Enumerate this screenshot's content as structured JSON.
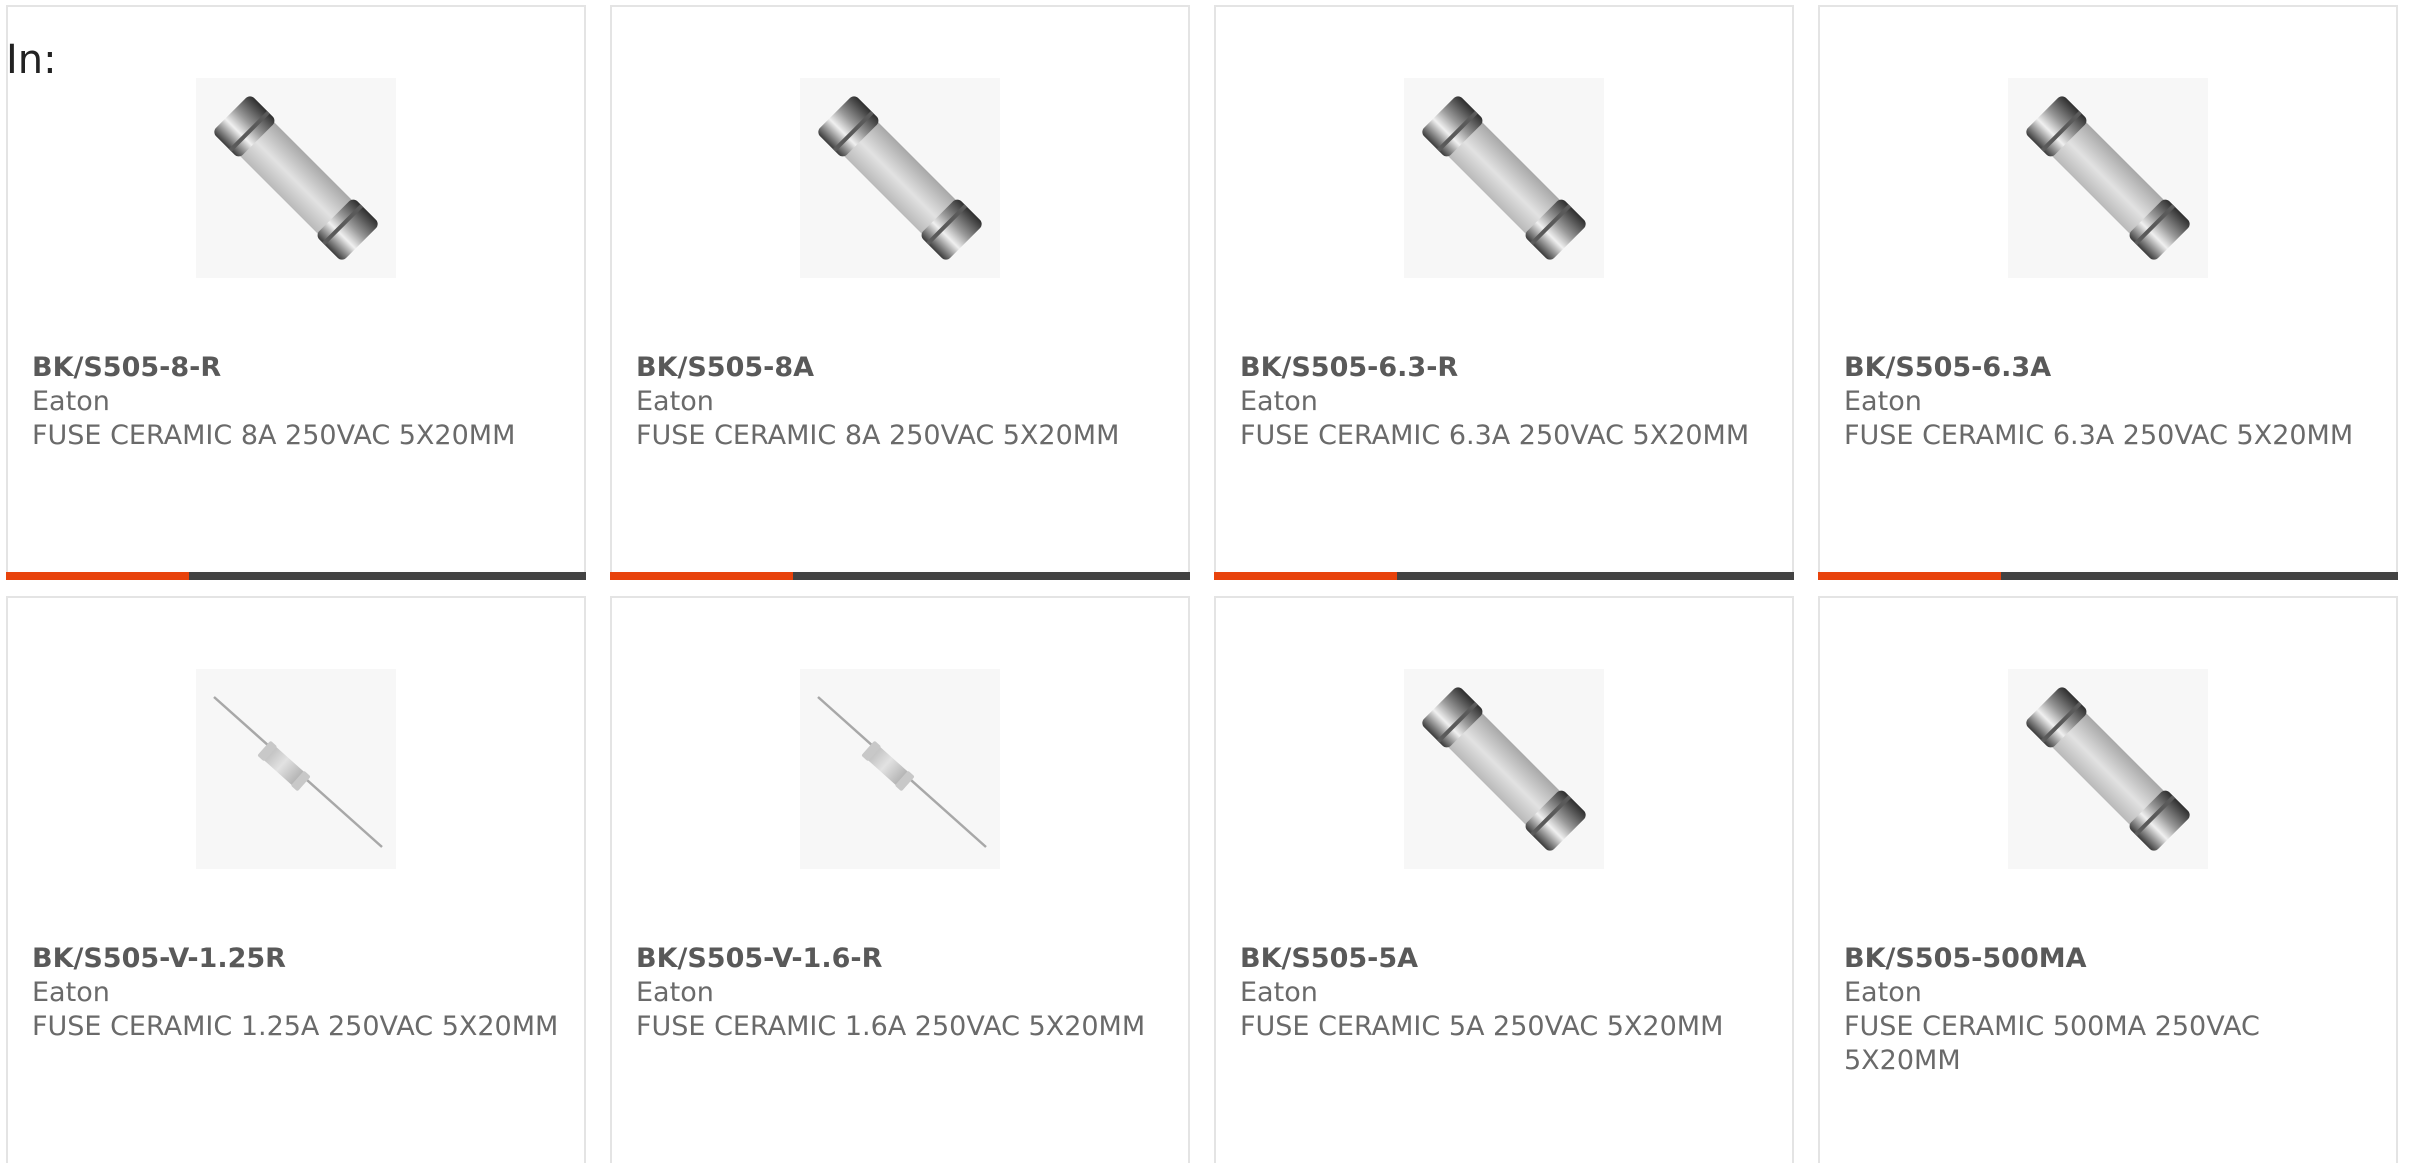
{
  "prefix_text": "In:",
  "colors": {
    "accent": "#e8430c",
    "bar": "#434343",
    "text": "#6a6a6a",
    "border": "#e4e4e4"
  },
  "products": [
    {
      "part": "BK/S505-8-R",
      "brand": "Eaton",
      "description": "FUSE CERAMIC 8A 250VAC 5X20MM",
      "image_icon": "cartridge-fuse-icon"
    },
    {
      "part": "BK/S505-8A",
      "brand": "Eaton",
      "description": "FUSE CERAMIC 8A 250VAC 5X20MM",
      "image_icon": "cartridge-fuse-icon"
    },
    {
      "part": "BK/S505-6.3-R",
      "brand": "Eaton",
      "description": "FUSE CERAMIC 6.3A 250VAC 5X20MM",
      "image_icon": "cartridge-fuse-icon"
    },
    {
      "part": "BK/S505-6.3A",
      "brand": "Eaton",
      "description": "FUSE CERAMIC 6.3A 250VAC 5X20MM",
      "image_icon": "cartridge-fuse-icon"
    },
    {
      "part": "BK/S505-V-1.25R",
      "brand": "Eaton",
      "description": "FUSE CERAMIC 1.25A 250VAC 5X20MM",
      "image_icon": "axial-fuse-icon"
    },
    {
      "part": "BK/S505-V-1.6-R",
      "brand": "Eaton",
      "description": "FUSE CERAMIC 1.6A 250VAC 5X20MM",
      "image_icon": "axial-fuse-icon"
    },
    {
      "part": "BK/S505-5A",
      "brand": "Eaton",
      "description": "FUSE CERAMIC 5A 250VAC 5X20MM",
      "image_icon": "cartridge-fuse-icon"
    },
    {
      "part": "BK/S505-500MA",
      "brand": "Eaton",
      "description": "FUSE CERAMIC 500MA 250VAC 5X20MM",
      "image_icon": "cartridge-fuse-icon"
    }
  ]
}
